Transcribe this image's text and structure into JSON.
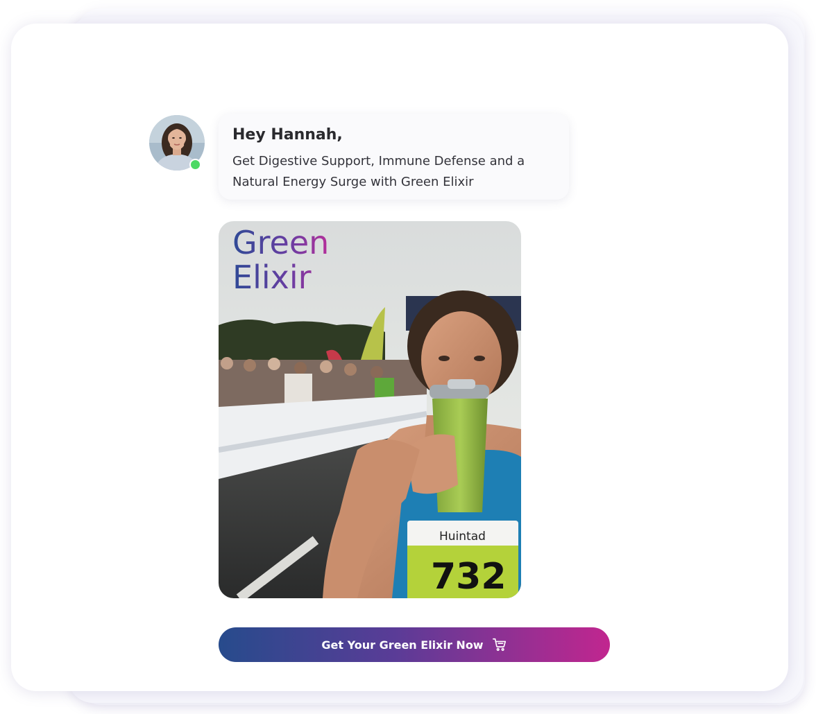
{
  "message": {
    "greeting": "Hey Hannah,",
    "body": "Get Digestive Support, Immune Defense and a Natural Energy Surge with Green Elixir"
  },
  "hero": {
    "title_line1": "Green",
    "title_line2": "Elixir",
    "bib_brand": "Huintad",
    "bib_number": "732"
  },
  "cta": {
    "label": "Get Your Green Elixir Now",
    "icon": "shopping-cart-icon"
  },
  "colors": {
    "online_status": "#4cd964",
    "gradient_start": "#274b8c",
    "gradient_end": "#c1268f"
  }
}
